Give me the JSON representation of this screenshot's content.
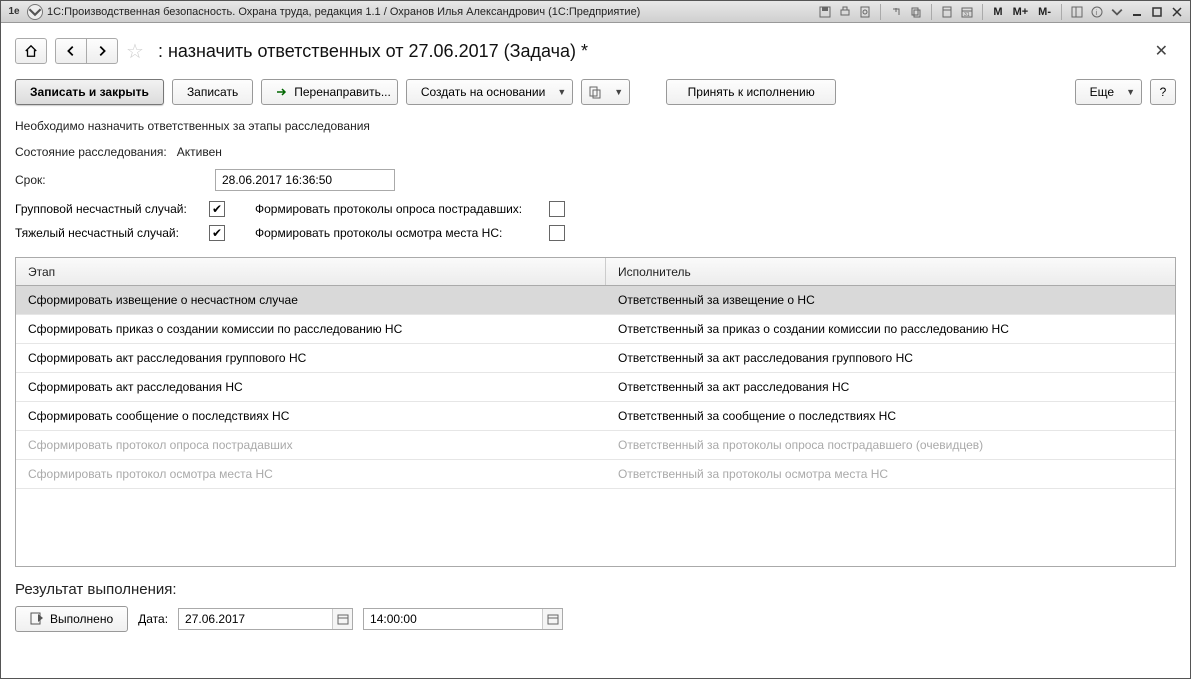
{
  "titlebar": {
    "app_icon": "1e",
    "title": "1С:Производственная безопасность. Охрана труда, редакция 1.1 / Охранов Илья Александрович  (1С:Предприятие)",
    "mem_buttons": [
      "M",
      "M+",
      "M-"
    ]
  },
  "header": {
    "title": ": назначить ответственных от 27.06.2017 (Задача) *"
  },
  "toolbar": {
    "save_close": "Записать и закрыть",
    "save": "Записать",
    "redirect": "Перенаправить...",
    "create_based": "Создать на основании",
    "accept": "Принять к исполнению",
    "more": "Еще",
    "help": "?"
  },
  "info": {
    "description": "Необходимо назначить ответственных за этапы расследования",
    "status_label": "Состояние расследования:",
    "status_value": "Активен",
    "deadline_label": "Срок:",
    "deadline_value": "28.06.2017 16:36:50"
  },
  "checks": {
    "group_label": "Групповой несчастный случай:",
    "group_checked": true,
    "form_protocols_victims_label": "Формировать протоколы опроса пострадавших:",
    "form_protocols_victims_checked": false,
    "severe_label": "Тяжелый несчастный случай:",
    "severe_checked": true,
    "form_protocols_site_label": "Формировать протоколы осмотра места НС:",
    "form_protocols_site_checked": false
  },
  "table": {
    "col_stage": "Этап",
    "col_exec": "Исполнитель",
    "rows": [
      {
        "stage": "Сформировать извещение о несчастном случае",
        "exec": "Ответственный за извещение о НС",
        "selected": true,
        "disabled": false
      },
      {
        "stage": "Сформировать приказ о создании комиссии по расследованию НС",
        "exec": "Ответственный за приказ о создании комиссии по расследованию НС",
        "selected": false,
        "disabled": false
      },
      {
        "stage": "Сформировать акт расследования группового НС",
        "exec": "Ответственный за акт расследования группового НС",
        "selected": false,
        "disabled": false
      },
      {
        "stage": "Сформировать акт расследования НС",
        "exec": "Ответственный за акт расследования НС",
        "selected": false,
        "disabled": false
      },
      {
        "stage": "Сформировать сообщение о последствиях НС",
        "exec": "Ответственный за сообщение о последствиях НС",
        "selected": false,
        "disabled": false
      },
      {
        "stage": "Сформировать протокол опроса пострадавших",
        "exec": "Ответственный за протоколы опроса пострадавшего (очевидцев)",
        "selected": false,
        "disabled": true
      },
      {
        "stage": "Сформировать протокол осмотра места НС",
        "exec": "Ответственный за протоколы осмотра места НС",
        "selected": false,
        "disabled": true
      }
    ]
  },
  "result": {
    "label": "Результат выполнения:",
    "done_btn": "Выполнено",
    "date_label": "Дата:",
    "date_value": "27.06.2017",
    "time_value": "14:00:00"
  }
}
